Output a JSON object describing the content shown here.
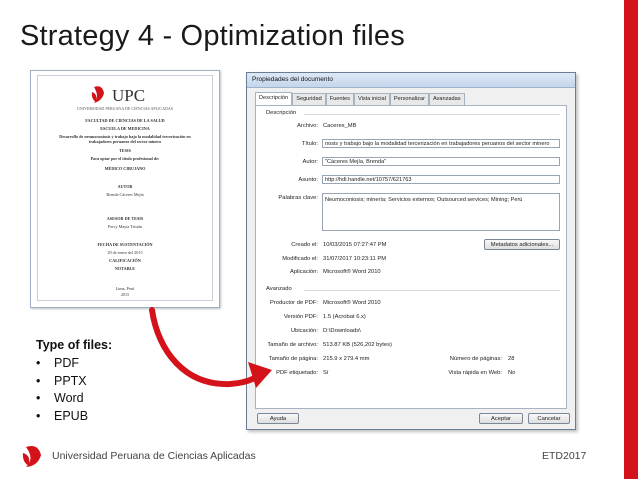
{
  "slide": {
    "title": "Strategy 4 - Optimization files",
    "accent_color": "#d3121a"
  },
  "cover": {
    "logo_text": "UPC",
    "logo_subtitle": "UNIVERSIDAD PERUANA DE CIENCIAS APLICADAS",
    "lines": [
      "FACULTAD DE CIENCIAS DE LA SALUD",
      "ESCUELA DE MEDICINA",
      "Desarrollo de neumoconiosis y trabajo bajo la modalidad tercerización en",
      "trabajadores peruanos del sector minero",
      "TESIS",
      "Para optar por el título profesional de:",
      "MÉDICO CIRUJANO",
      "AUTOR",
      "Brenda Cáceres Mejía",
      "ASESOR DE TESIS",
      "Percy Mayta Tristán",
      "FECHA DE SUSTENTACIÓN",
      "29 de enero del 2015",
      "CALIFICACIÓN",
      "NOTABLE",
      "Lima, Perú",
      "2015"
    ]
  },
  "dialog": {
    "title": "Propiedades del documento",
    "tabs": [
      "Descripción",
      "Seguridad",
      "Fuentes",
      "Vista inicial",
      "Personalizar",
      "Avanzadas"
    ],
    "description_group": "Descripción",
    "file_label": "Archivo:",
    "file_value": "Caceres_MB",
    "title_label": "Título:",
    "title_value": "nosis y trabajo bajo la modalidad tercerización en trabajadores peruanos del sector minero",
    "author_label": "Autor:",
    "author_value": "\"Cáceres Mejía, Brenda\"",
    "subject_label": "Asunto:",
    "subject_value": "http://hdl.handle.net/10757/621763",
    "keywords_label": "Palabras clave:",
    "keywords_value": "Neumoconiosis; minería; Servicios externos; Outsourced services; Mining; Perú",
    "created_label": "Creado el:",
    "created_value": "10/03/2015 07:27:47 PM",
    "modified_label": "Modificado el:",
    "modified_value": "31/07/2017 10:23:11 PM",
    "app_label": "Aplicación:",
    "app_value": "Microsoft® Word 2010",
    "metadata_button": "Metadatos adicionales...",
    "advanced_group": "Avanzado",
    "pdf_producer_label": "Productor de PDF:",
    "pdf_producer_value": "Microsoft® Word 2010",
    "pdf_version_label": "Versión PDF:",
    "pdf_version_value": "1.5 (Acrobat 6.x)",
    "location_label": "Ubicación:",
    "location_value": "D:\\Downloads\\",
    "file_size_label": "Tamaño de archivo:",
    "file_size_value": "513.87 KB (526,202 bytes)",
    "page_size_label": "Tamaño de página:",
    "page_size_value": "215.9 x 279.4 mm",
    "pages_label": "Número de páginas:",
    "pages_value": "28",
    "tagged_label": "PDF etiquetado:",
    "tagged_value": "Sí",
    "fast_web_label": "Vista rápida en Web:",
    "fast_web_value": "No",
    "help_button": "Ayuda",
    "ok_button": "Aceptar",
    "cancel_button": "Cancelar"
  },
  "types": {
    "title": "Type of files:",
    "items": [
      "PDF",
      "PPTX",
      "Word",
      "EPUB"
    ]
  },
  "footer": {
    "university": "Universidad Peruana de Ciencias Aplicadas",
    "event": "ETD2017"
  }
}
